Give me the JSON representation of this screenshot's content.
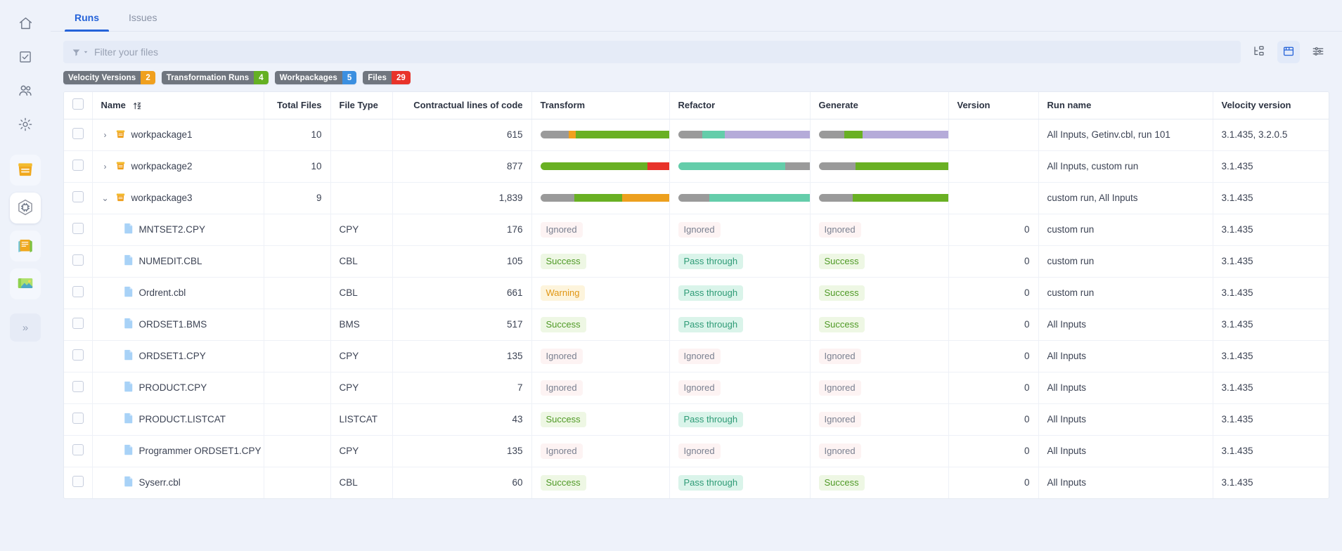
{
  "sidebar": {
    "items": [
      {
        "name": "home-icon",
        "label": "Home"
      },
      {
        "name": "tasks-icon",
        "label": "Tasks"
      },
      {
        "name": "users-icon",
        "label": "Users"
      },
      {
        "name": "gear-icon",
        "label": "Settings"
      }
    ],
    "apps": [
      {
        "name": "file-tray-icon",
        "label": "Files",
        "active": false
      },
      {
        "name": "hexagon-chip-icon",
        "label": "Transform",
        "active": true
      },
      {
        "name": "notebook-icon",
        "label": "Notebook",
        "active": false
      },
      {
        "name": "image-icon",
        "label": "Gallery",
        "active": false
      }
    ],
    "expand_label": "»"
  },
  "tabs": [
    {
      "label": "Runs",
      "active": true
    },
    {
      "label": "Issues",
      "active": false
    }
  ],
  "search": {
    "placeholder": "Filter your files",
    "value": ""
  },
  "toolbar_buttons": [
    {
      "name": "tree-view-icon",
      "label": "Tree view",
      "active": false
    },
    {
      "name": "table-view-icon",
      "label": "Table view",
      "active": true
    },
    {
      "name": "column-settings-icon",
      "label": "Settings",
      "active": false
    }
  ],
  "chips": [
    {
      "label": "Velocity Versions",
      "count": "2",
      "color": "#f0a01e"
    },
    {
      "label": "Transformation Runs",
      "count": "4",
      "color": "#64b023"
    },
    {
      "label": "Workpackages",
      "count": "5",
      "color": "#3b8fe0"
    },
    {
      "label": "Files",
      "count": "29",
      "color": "#e8332a"
    }
  ],
  "table": {
    "columns": [
      {
        "key": "name",
        "label": "Name",
        "sortable": true
      },
      {
        "key": "total_files",
        "label": "Total Files"
      },
      {
        "key": "file_type",
        "label": "File Type"
      },
      {
        "key": "cloc",
        "label": "Contractual lines of code"
      },
      {
        "key": "transform",
        "label": "Transform"
      },
      {
        "key": "refactor",
        "label": "Refactor"
      },
      {
        "key": "generate",
        "label": "Generate"
      },
      {
        "key": "version",
        "label": "Version"
      },
      {
        "key": "run_name",
        "label": "Run name"
      },
      {
        "key": "velocity_version",
        "label": "Velocity version"
      }
    ],
    "rows": [
      {
        "kind": "workpackage",
        "expanded": false,
        "caret": "›",
        "icon": "workpackage-icon",
        "name": "workpackage1",
        "total_files": "10",
        "file_type": "",
        "cloc": "615",
        "transform": {
          "type": "bar",
          "segments": [
            {
              "color": "#9a9a9a",
              "pct": 20
            },
            {
              "color": "#f0a01e",
              "pct": 5
            },
            {
              "color": "#69b023",
              "pct": 71
            },
            {
              "color": "#e8332a",
              "pct": 4
            }
          ]
        },
        "refactor": {
          "type": "bar",
          "segments": [
            {
              "color": "#9a9a9a",
              "pct": 17
            },
            {
              "color": "#64cdaa",
              "pct": 16
            },
            {
              "color": "#b5abd9",
              "pct": 67
            }
          ]
        },
        "generate": {
          "type": "bar",
          "segments": [
            {
              "color": "#9a9a9a",
              "pct": 18
            },
            {
              "color": "#69b023",
              "pct": 13
            },
            {
              "color": "#b5abd9",
              "pct": 69
            }
          ]
        },
        "version": "",
        "run_name": "All Inputs, Getinv.cbl, run 101",
        "velocity_version": "3.1.435, 3.2.0.5"
      },
      {
        "kind": "workpackage",
        "expanded": false,
        "caret": "›",
        "icon": "workpackage-icon",
        "name": "workpackage2",
        "total_files": "10",
        "file_type": "",
        "cloc": "877",
        "transform": {
          "type": "bar",
          "segments": [
            {
              "color": "#69b023",
              "pct": 76
            },
            {
              "color": "#e8332a",
              "pct": 18
            },
            {
              "color": "#9a9a9a",
              "pct": 6
            }
          ]
        },
        "refactor": {
          "type": "bar",
          "segments": [
            {
              "color": "#64cdaa",
              "pct": 76
            },
            {
              "color": "#9a9a9a",
              "pct": 24
            }
          ]
        },
        "generate": {
          "type": "bar",
          "segments": [
            {
              "color": "#9a9a9a",
              "pct": 26
            },
            {
              "color": "#69b023",
              "pct": 74
            }
          ]
        },
        "version": "",
        "run_name": "All Inputs, custom run",
        "velocity_version": "3.1.435"
      },
      {
        "kind": "workpackage",
        "expanded": true,
        "caret": "⌄",
        "icon": "workpackage-icon",
        "name": "workpackage3",
        "total_files": "9",
        "file_type": "",
        "cloc": "1,839",
        "transform": {
          "type": "bar",
          "segments": [
            {
              "color": "#9a9a9a",
              "pct": 24
            },
            {
              "color": "#69b023",
              "pct": 34
            },
            {
              "color": "#eda01e",
              "pct": 42
            }
          ]
        },
        "refactor": {
          "type": "bar",
          "segments": [
            {
              "color": "#9a9a9a",
              "pct": 22
            },
            {
              "color": "#64cdaa",
              "pct": 78
            }
          ]
        },
        "generate": {
          "type": "bar",
          "segments": [
            {
              "color": "#9a9a9a",
              "pct": 24
            },
            {
              "color": "#69b023",
              "pct": 76
            }
          ]
        },
        "version": "",
        "run_name": "custom run, All Inputs",
        "velocity_version": "3.1.435"
      },
      {
        "kind": "file",
        "icon": "file-icon",
        "name": "MNTSET2.CPY",
        "total_files": "",
        "file_type": "CPY",
        "cloc": "176",
        "transform": {
          "type": "pill",
          "text": "Ignored",
          "style": "ignored"
        },
        "refactor": {
          "type": "pill",
          "text": "Ignored",
          "style": "ignored"
        },
        "generate": {
          "type": "pill",
          "text": "Ignored",
          "style": "ignored"
        },
        "version": "0",
        "run_name": "custom run",
        "velocity_version": "3.1.435"
      },
      {
        "kind": "file",
        "icon": "file-icon",
        "name": "NUMEDIT.CBL",
        "total_files": "",
        "file_type": "CBL",
        "cloc": "105",
        "transform": {
          "type": "pill",
          "text": "Success",
          "style": "success"
        },
        "refactor": {
          "type": "pill",
          "text": "Pass through",
          "style": "pass"
        },
        "generate": {
          "type": "pill",
          "text": "Success",
          "style": "success"
        },
        "version": "0",
        "run_name": "custom run",
        "velocity_version": "3.1.435"
      },
      {
        "kind": "file",
        "icon": "file-icon",
        "name": "Ordrent.cbl",
        "total_files": "",
        "file_type": "CBL",
        "cloc": "661",
        "transform": {
          "type": "pill",
          "text": "Warning",
          "style": "warning"
        },
        "refactor": {
          "type": "pill",
          "text": "Pass through",
          "style": "pass"
        },
        "generate": {
          "type": "pill",
          "text": "Success",
          "style": "success"
        },
        "version": "0",
        "run_name": "custom run",
        "velocity_version": "3.1.435"
      },
      {
        "kind": "file",
        "icon": "file-icon",
        "name": "ORDSET1.BMS",
        "total_files": "",
        "file_type": "BMS",
        "cloc": "517",
        "transform": {
          "type": "pill",
          "text": "Success",
          "style": "success"
        },
        "refactor": {
          "type": "pill",
          "text": "Pass through",
          "style": "pass"
        },
        "generate": {
          "type": "pill",
          "text": "Success",
          "style": "success"
        },
        "version": "0",
        "run_name": "All Inputs",
        "velocity_version": "3.1.435"
      },
      {
        "kind": "file",
        "icon": "file-icon",
        "name": "ORDSET1.CPY",
        "total_files": "",
        "file_type": "CPY",
        "cloc": "135",
        "transform": {
          "type": "pill",
          "text": "Ignored",
          "style": "ignored"
        },
        "refactor": {
          "type": "pill",
          "text": "Ignored",
          "style": "ignored"
        },
        "generate": {
          "type": "pill",
          "text": "Ignored",
          "style": "ignored"
        },
        "version": "0",
        "run_name": "All Inputs",
        "velocity_version": "3.1.435"
      },
      {
        "kind": "file",
        "icon": "file-icon",
        "name": "PRODUCT.CPY",
        "total_files": "",
        "file_type": "CPY",
        "cloc": "7",
        "transform": {
          "type": "pill",
          "text": "Ignored",
          "style": "ignored"
        },
        "refactor": {
          "type": "pill",
          "text": "Ignored",
          "style": "ignored"
        },
        "generate": {
          "type": "pill",
          "text": "Ignored",
          "style": "ignored"
        },
        "version": "0",
        "run_name": "All Inputs",
        "velocity_version": "3.1.435"
      },
      {
        "kind": "file",
        "icon": "file-icon",
        "name": "PRODUCT.LISTCAT",
        "total_files": "",
        "file_type": "LISTCAT",
        "cloc": "43",
        "transform": {
          "type": "pill",
          "text": "Success",
          "style": "success"
        },
        "refactor": {
          "type": "pill",
          "text": "Pass through",
          "style": "pass"
        },
        "generate": {
          "type": "pill",
          "text": "Ignored",
          "style": "ignored"
        },
        "version": "0",
        "run_name": "All Inputs",
        "velocity_version": "3.1.435"
      },
      {
        "kind": "file",
        "icon": "file-icon",
        "name": "Programmer ORDSET1.CPY",
        "total_files": "",
        "file_type": "CPY",
        "cloc": "135",
        "transform": {
          "type": "pill",
          "text": "Ignored",
          "style": "ignored"
        },
        "refactor": {
          "type": "pill",
          "text": "Ignored",
          "style": "ignored"
        },
        "generate": {
          "type": "pill",
          "text": "Ignored",
          "style": "ignored"
        },
        "version": "0",
        "run_name": "All Inputs",
        "velocity_version": "3.1.435"
      },
      {
        "kind": "file",
        "icon": "file-icon",
        "name": "Syserr.cbl",
        "total_files": "",
        "file_type": "CBL",
        "cloc": "60",
        "transform": {
          "type": "pill",
          "text": "Success",
          "style": "success"
        },
        "refactor": {
          "type": "pill",
          "text": "Pass through",
          "style": "pass"
        },
        "generate": {
          "type": "pill",
          "text": "Success",
          "style": "success"
        },
        "version": "0",
        "run_name": "All Inputs",
        "velocity_version": "3.1.435"
      }
    ]
  }
}
